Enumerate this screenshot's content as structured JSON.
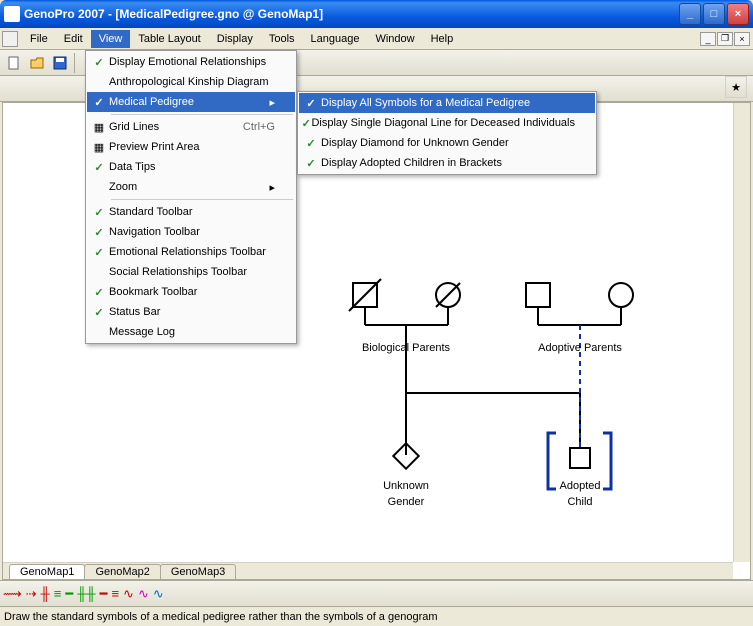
{
  "title": "GenoPro 2007 - [MedicalPedigree.gno @ GenoMap1]",
  "menus": [
    "File",
    "Edit",
    "View",
    "Table Layout",
    "Display",
    "Tools",
    "Language",
    "Window",
    "Help"
  ],
  "viewMenu": {
    "items": [
      {
        "label": "Display Emotional Relationships",
        "checked": true
      },
      {
        "label": "Anthropological Kinship Diagram",
        "checked": false
      },
      {
        "label": "Medical Pedigree",
        "checked": true,
        "submenu": true,
        "highlighted": true
      },
      {
        "divider": true
      },
      {
        "label": "Grid Lines",
        "icon": "grid",
        "accel": "Ctrl+G"
      },
      {
        "label": "Preview Print Area",
        "icon": "print"
      },
      {
        "label": "Data Tips",
        "checked": true
      },
      {
        "label": "Zoom",
        "submenu": true
      },
      {
        "divider": true
      },
      {
        "label": "Standard Toolbar",
        "checked": true
      },
      {
        "label": "Navigation Toolbar",
        "checked": true
      },
      {
        "label": "Emotional Relationships Toolbar",
        "checked": true
      },
      {
        "label": "Social Relationships Toolbar",
        "checked": false
      },
      {
        "label": "Bookmark Toolbar",
        "checked": true
      },
      {
        "label": "Status Bar",
        "checked": true
      },
      {
        "label": "Message Log",
        "checked": false
      }
    ]
  },
  "subMenu": {
    "items": [
      {
        "label": "Display All Symbols for a Medical Pedigree",
        "checked": true,
        "highlighted": true
      },
      {
        "label": "Display Single Diagonal Line for Deceased Individuals",
        "checked": true
      },
      {
        "label": "Display Diamond for Unknown Gender",
        "checked": true
      },
      {
        "label": "Display Adopted Children in Brackets",
        "checked": true
      }
    ]
  },
  "tabs": [
    "GenoMap1",
    "GenoMap2",
    "GenoMap3"
  ],
  "status": "Draw the standard symbols of a medical pedigree rather than the symbols of a genogram",
  "canvas": {
    "labels": {
      "bioParents": "Biological Parents",
      "adoptParents": "Adoptive Parents",
      "unknownGender1": "Unknown",
      "unknownGender2": "Gender",
      "adoptedChild1": "Adopted",
      "adoptedChild2": "Child"
    }
  }
}
